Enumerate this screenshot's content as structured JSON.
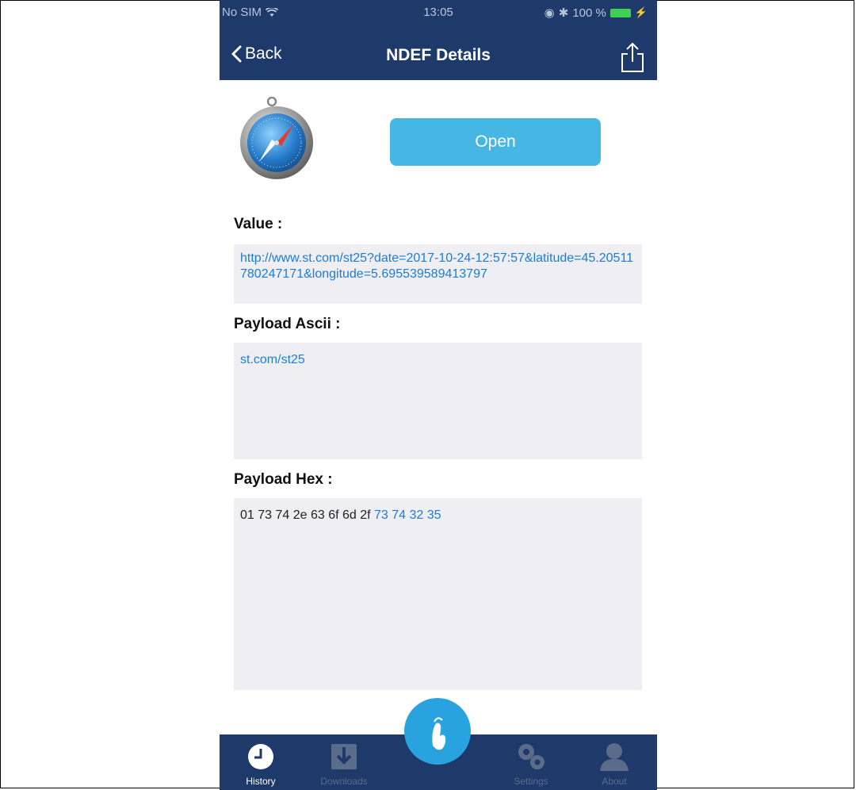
{
  "status_bar": {
    "carrier": "No SIM",
    "time": "13:05",
    "battery_text": "100 %"
  },
  "nav": {
    "back_label": "Back",
    "title": "NDEF Details"
  },
  "main": {
    "open_label": "Open",
    "value_label": "Value :",
    "value_text": "http://www.st.com/st25?date=2017-10-24-12:57:57&latitude=45.20511780247171&longitude=5.695539589413797",
    "payload_ascii_label": "Payload Ascii :",
    "payload_ascii_text": "st.com/st25",
    "payload_hex_label": "Payload Hex :",
    "payload_hex_prefix": "01 73 74 2e 63 6f 6d 2f ",
    "payload_hex_highlight": "73 74 32 35"
  },
  "tabbar": {
    "items": [
      {
        "label": "History",
        "icon": "clock-icon"
      },
      {
        "label": "Downloads",
        "icon": "download-icon"
      },
      {
        "label": "",
        "icon": "nfc-tap-icon"
      },
      {
        "label": "Settings",
        "icon": "gears-icon"
      },
      {
        "label": "About",
        "icon": "person-icon"
      }
    ]
  },
  "colors": {
    "nav_bg": "#1e3a6a",
    "accent": "#46b7e4",
    "link": "#1b7ddb",
    "box_bg": "#eeeef3"
  }
}
